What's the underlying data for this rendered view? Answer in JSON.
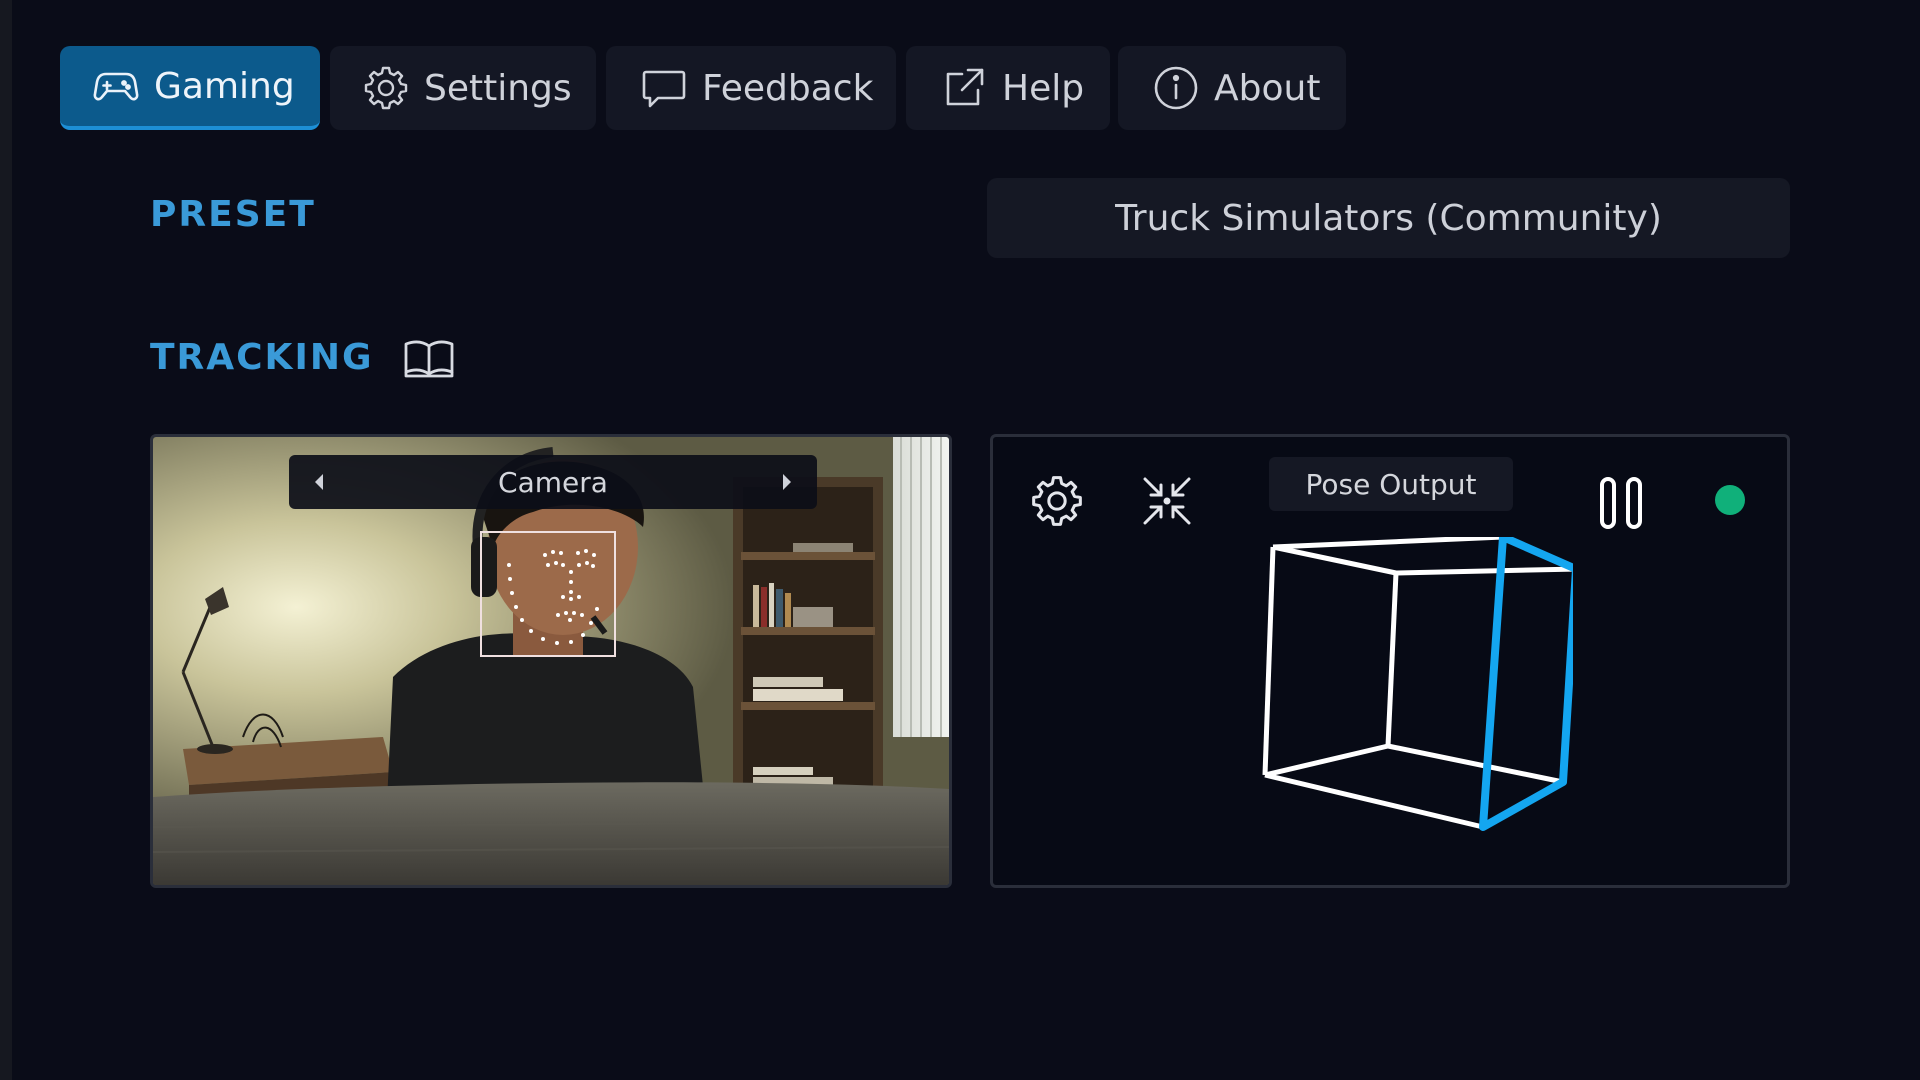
{
  "nav": {
    "items": [
      {
        "label": "Gaming",
        "icon": "gamepad-icon",
        "active": true
      },
      {
        "label": "Settings",
        "icon": "gear-icon",
        "active": false
      },
      {
        "label": "Feedback",
        "icon": "speech-bubble-icon",
        "active": false
      },
      {
        "label": "Help",
        "icon": "external-link-icon",
        "active": false
      },
      {
        "label": "About",
        "icon": "info-icon",
        "active": false
      }
    ]
  },
  "preset": {
    "heading": "PRESET",
    "selected": "Truck Simulators (Community)"
  },
  "tracking": {
    "heading": "TRACKING",
    "camera": {
      "label": "Camera"
    },
    "pose": {
      "label": "Pose Output",
      "status": "active"
    }
  },
  "colors": {
    "background": "#0a0c18",
    "accent": "#3a9ad8",
    "active_tab": "#0c5a8c",
    "status_ok": "#10b07a",
    "cube_front": "#14a6f0",
    "cube_edges": "#ffffff"
  }
}
